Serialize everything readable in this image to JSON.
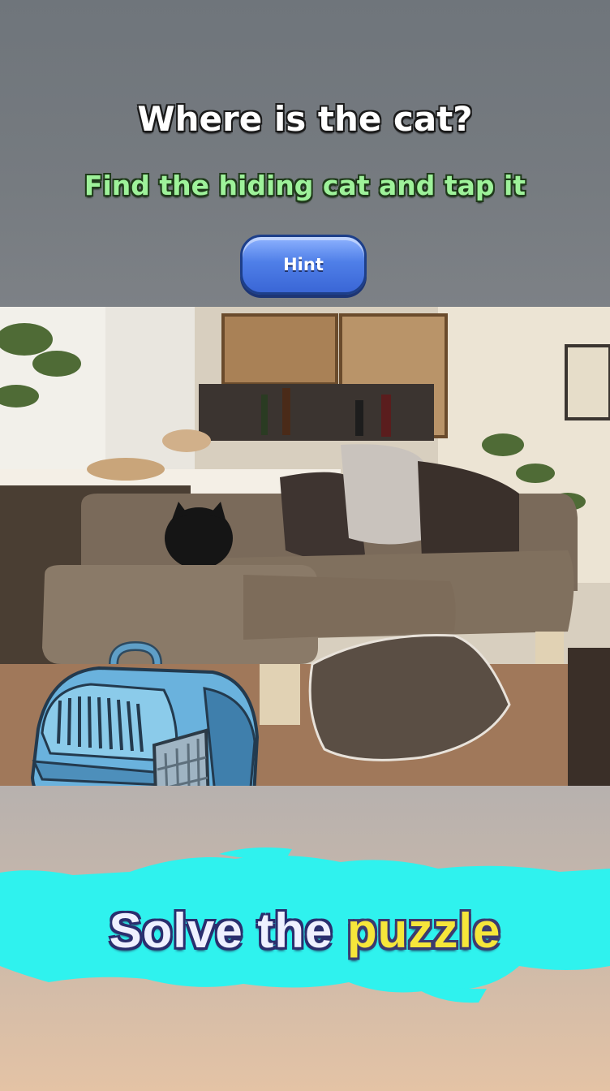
{
  "header": {
    "title": "Where is the cat?",
    "subtitle": "Find the hiding cat and tap it",
    "hint_label": "Hint"
  },
  "footer": {
    "tagline_part1": "Solve the",
    "tagline_part2": "puzzle"
  },
  "colors": {
    "subtitle": "#9ef29a",
    "hint_button": "#4f7fe8",
    "banner": "#2ff2ee",
    "tagline_highlight": "#f6e63a"
  },
  "icons": {
    "carrier": "pet-carrier-icon",
    "hidden_cat": "hidden-cat-silhouette"
  }
}
